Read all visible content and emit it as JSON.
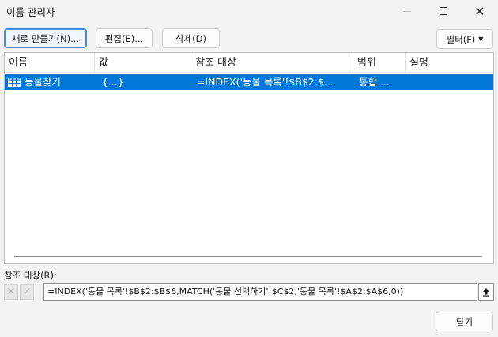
{
  "window": {
    "title": "이름 관리자"
  },
  "toolbar": {
    "new_label": "새로 만들기(N)...",
    "edit_label": "편집(E)...",
    "delete_label": "삭제(D)",
    "filter_label": "필터(F)"
  },
  "list": {
    "columns": [
      "이름",
      "값",
      "참조 대상",
      "범위",
      "설명"
    ],
    "rows": [
      {
        "name": "동물찾기",
        "value": "{...}",
        "refers_to": "=INDEX('동물 목록'!$B$2:$...",
        "scope": "통합 ...",
        "comment": ""
      }
    ]
  },
  "reference": {
    "label": "참조 대상(R):",
    "value": "=INDEX('동물 목록'!$B$2:$B$6,MATCH('동물 선택하기'!$C$2,'동물 목록'!$A$2:$A$6,0))"
  },
  "footer": {
    "close_label": "닫기"
  },
  "colors": {
    "selection": "#0078d7",
    "accent_border": "#4a8bd8"
  },
  "icons": [
    "minimize-icon",
    "maximize-icon",
    "close-icon",
    "chevron-down-icon",
    "table-name-icon",
    "cancel-x-icon",
    "checkmark-icon",
    "collapse-up-arrow-icon"
  ]
}
